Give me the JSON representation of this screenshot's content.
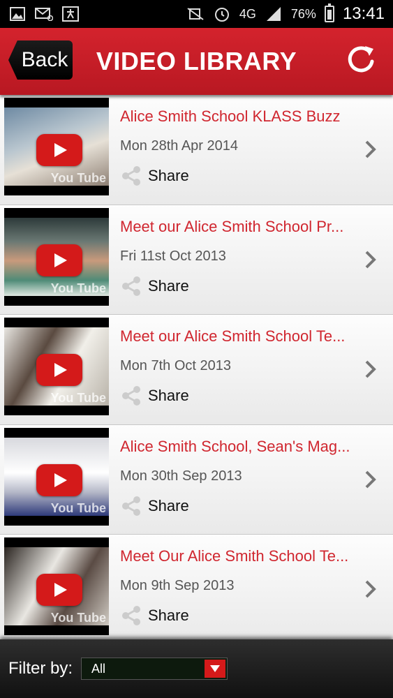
{
  "status_bar": {
    "network": "4G",
    "battery": "76%",
    "time": "13:41",
    "icons": [
      "image-icon",
      "mail-icon",
      "app-icon",
      "mute-icon",
      "alarm-icon",
      "signal-icon",
      "battery-icon"
    ]
  },
  "header": {
    "back_label": "Back",
    "title": "VIDEO LIBRARY",
    "refresh_icon": "refresh-icon",
    "color": "#c8202a"
  },
  "videos": [
    {
      "title": "Alice Smith School KLASS Buzz",
      "date": "Mon 28th Apr 2014",
      "share_label": "Share"
    },
    {
      "title": "Meet our Alice Smith School Pr...",
      "date": "Fri 11st Oct 2013",
      "share_label": "Share"
    },
    {
      "title": "Meet our Alice Smith School Te...",
      "date": "Mon 7th Oct 2013",
      "share_label": "Share"
    },
    {
      "title": "Alice Smith School, Sean's Mag...",
      "date": "Mon 30th Sep 2013",
      "share_label": "Share"
    },
    {
      "title": "Meet Our Alice Smith School Te...",
      "date": "Mon 9th Sep 2013",
      "share_label": "Share"
    }
  ],
  "thumb_watermark": "You Tube",
  "footer": {
    "filter_label": "Filter by:",
    "filter_value": "All"
  },
  "colors": {
    "accent": "#d0262f",
    "play_button": "#d41a1a"
  }
}
